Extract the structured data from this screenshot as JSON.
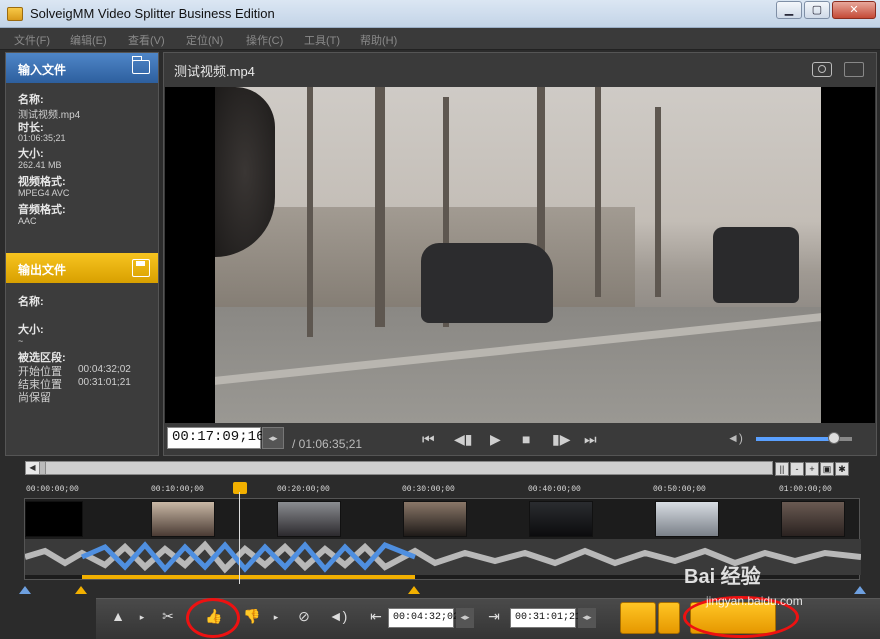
{
  "window": {
    "title": "SolveigMM Video Splitter Business Edition",
    "minimize": "▁",
    "maximize": "▢",
    "close": "✕"
  },
  "menu": [
    "文件(F)",
    "编辑(E)",
    "查看(V)",
    "定位(N)",
    "操作(C)",
    "工具(T)",
    "帮助(H)"
  ],
  "input_panel": {
    "header": "输入文件",
    "name_label": "名称:",
    "name_value": "测试视频.mp4",
    "duration_label": "时长:",
    "duration_value": "01:06:35;21",
    "size_label": "大小:",
    "size_value": "262.41 MB",
    "video_format_label": "视频格式:",
    "video_format_value": "MPEG4 AVC",
    "audio_format_label": "音频格式:",
    "audio_format_value": "AAC"
  },
  "output_panel": {
    "header": "输出文件",
    "name_label": "名称:",
    "size_label": "大小:",
    "size_value": "~",
    "range_label": "被选区段:",
    "start_label": "开始位置",
    "start_value": "00:04:32;02",
    "end_label": "结束位置",
    "end_value": "00:31:01;21",
    "keep_label": "尚保留"
  },
  "video": {
    "filename": "测试视频.mp4",
    "timecode": "00:17:09;16",
    "duration": "/ 01:06:35;21",
    "volume_fraction": 0.8
  },
  "playback_buttons": [
    "⏮",
    "◀▮",
    "▶",
    "■",
    "▮▶",
    "⏭"
  ],
  "timeline": {
    "ticks": [
      "00:00:00;00",
      "00:10:00;00",
      "00:20:00;00",
      "00:30:00;00",
      "00:40:00;00",
      "00:50:00;00",
      "01:00:00;00"
    ],
    "zoom_icons": [
      "||",
      "-",
      "+",
      "▣",
      "✱"
    ]
  },
  "toolbar": {
    "start_time": "00:04:32;02",
    "end_time": "00:31:01;21"
  },
  "watermark": {
    "brand": "Bai 经验",
    "site": "jingyan.baidu.com"
  },
  "colors": {
    "input_header": "#2d5f9e",
    "output_header": "#f2b000",
    "accent_orange": "#f2b000",
    "volume_blue": "#5aa0ff",
    "highlight_red": "#e11111"
  }
}
